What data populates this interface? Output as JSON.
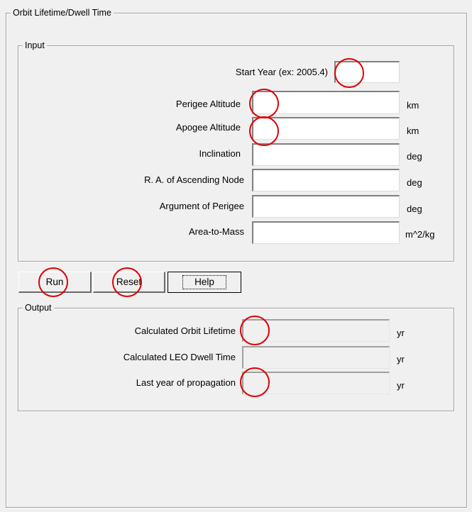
{
  "window": {
    "group_title": "Orbit Lifetime/Dwell Time"
  },
  "input": {
    "title": "Input",
    "fields": [
      {
        "label": "Start Year (ex: 2005.4)",
        "unit": "",
        "value": ""
      },
      {
        "label": "Perigee Altitude",
        "unit": "km",
        "value": ""
      },
      {
        "label": "Apogee Altitude",
        "unit": "km",
        "value": ""
      },
      {
        "label": "Inclination",
        "unit": "deg",
        "value": ""
      },
      {
        "label": "R. A. of Ascending Node",
        "unit": "deg",
        "value": ""
      },
      {
        "label": "Argument of Perigee",
        "unit": "deg",
        "value": ""
      },
      {
        "label": "Area-to-Mass",
        "unit": "m^2/kg",
        "value": ""
      }
    ]
  },
  "buttons": {
    "run": "Run",
    "reset": "Reset",
    "help": "Help"
  },
  "output": {
    "title": "Output",
    "fields": [
      {
        "label": "Calculated Orbit Lifetime",
        "unit": "yr",
        "value": ""
      },
      {
        "label": "Calculated LEO Dwell Time",
        "unit": "yr",
        "value": ""
      },
      {
        "label": "Last year of propagation",
        "unit": "yr",
        "value": ""
      }
    ]
  },
  "annotation_color": "#e00000"
}
